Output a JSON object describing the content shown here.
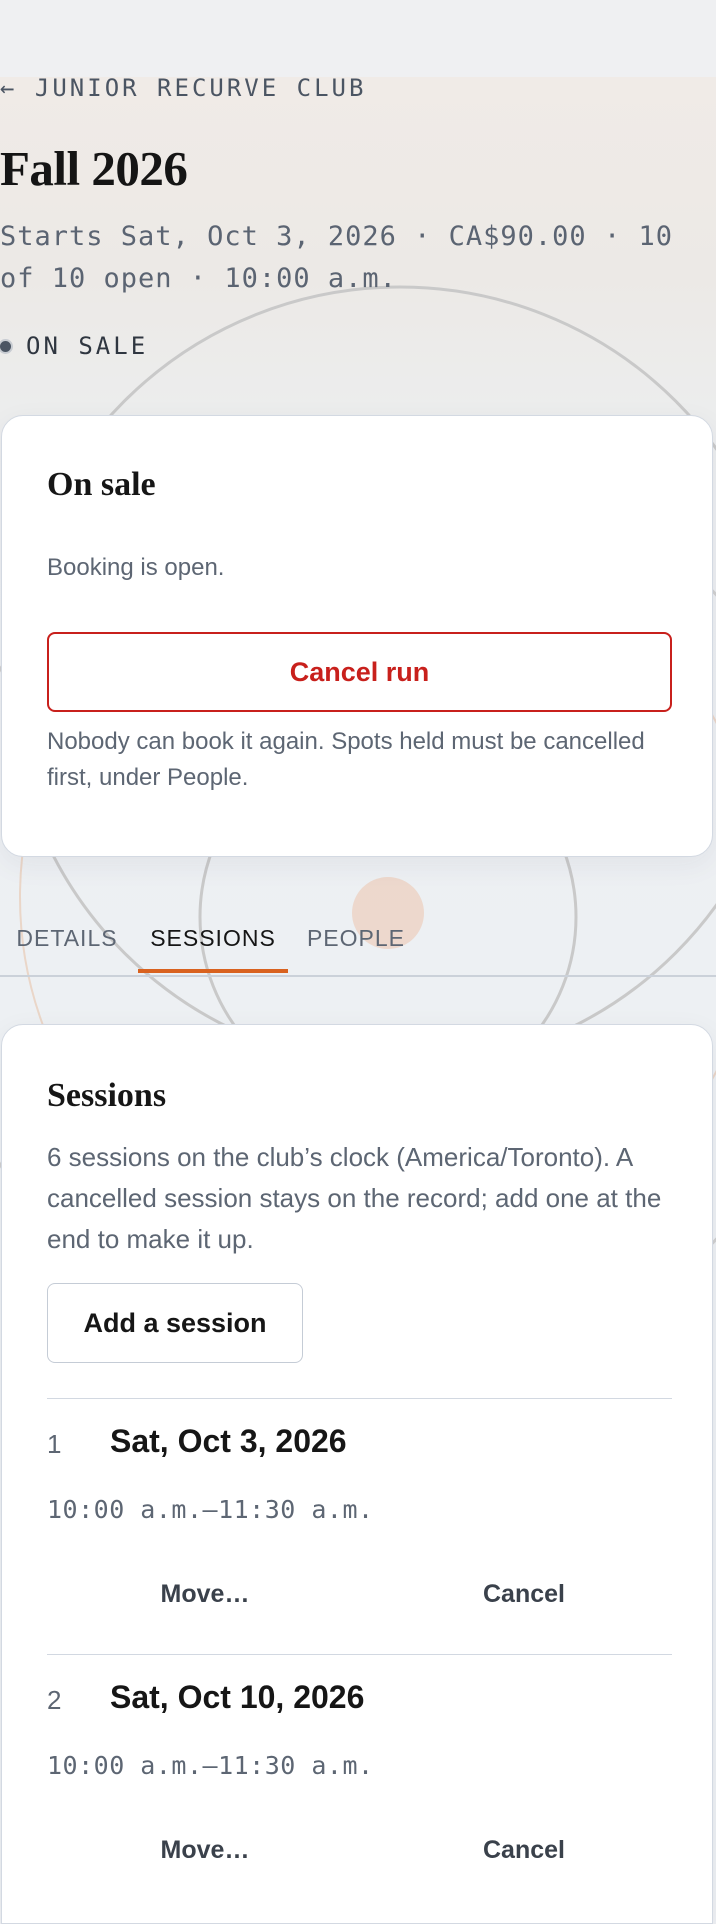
{
  "header": {
    "back_label": "← JUNIOR RECURVE CLUB",
    "title": "Fall 2026",
    "summary": "Starts Sat, Oct 3, 2026 · CA$90.00 · 10 of 10 open · 10:00 a.m.",
    "status": "ON SALE"
  },
  "sale_card": {
    "title": "On sale",
    "body": "Booking is open.",
    "cancel_button": "Cancel run",
    "note": "Nobody can book it again. Spots held must be cancelled first, under People."
  },
  "tabs": [
    {
      "label": "DETAILS",
      "active": false
    },
    {
      "label": "SESSIONS",
      "active": true
    },
    {
      "label": "PEOPLE",
      "active": false
    }
  ],
  "sessions_card": {
    "title": "Sessions",
    "description": "6 sessions on the club’s clock (America/Toronto). A cancelled session stays on the record; add one at the end to make it up.",
    "add_button": "Add a session",
    "items": [
      {
        "number": "1",
        "date": "Sat, Oct 3, 2026",
        "time": "10:00 a.m.–11:30 a.m.",
        "move_label": "Move…",
        "cancel_label": "Cancel"
      },
      {
        "number": "2",
        "date": "Sat, Oct 10, 2026",
        "time": "10:00 a.m.–11:30 a.m.",
        "move_label": "Move…",
        "cancel_label": "Cancel"
      }
    ]
  },
  "colors": {
    "accent": "#d9621f",
    "danger": "#c8201c",
    "page_background": "#eef0f3"
  }
}
